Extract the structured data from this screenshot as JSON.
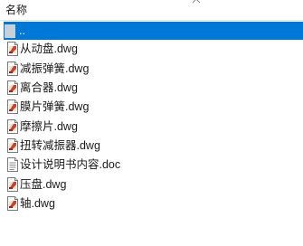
{
  "header": {
    "column_label": "名称"
  },
  "files": [
    {
      "name": "..",
      "icon": "parent-folder-icon",
      "selected": true
    },
    {
      "name": "从动盘.dwg",
      "icon": "dwg-file-icon",
      "selected": false
    },
    {
      "name": "减振弹簧.dwg",
      "icon": "dwg-file-icon",
      "selected": false
    },
    {
      "name": "离合器.dwg",
      "icon": "dwg-file-icon",
      "selected": false
    },
    {
      "name": "膜片弹簧.dwg",
      "icon": "dwg-file-icon",
      "selected": false
    },
    {
      "name": "摩擦片.dwg",
      "icon": "dwg-file-icon",
      "selected": false
    },
    {
      "name": "扭转减振器.dwg",
      "icon": "dwg-file-icon",
      "selected": false
    },
    {
      "name": "设计说明书内容.doc",
      "icon": "doc-file-icon",
      "selected": false
    },
    {
      "name": "压盘.dwg",
      "icon": "dwg-file-icon",
      "selected": false
    },
    {
      "name": "轴.dwg",
      "icon": "dwg-file-icon",
      "selected": false
    }
  ],
  "colors": {
    "selection": "#0078d7",
    "text": "#1a1a1a"
  }
}
